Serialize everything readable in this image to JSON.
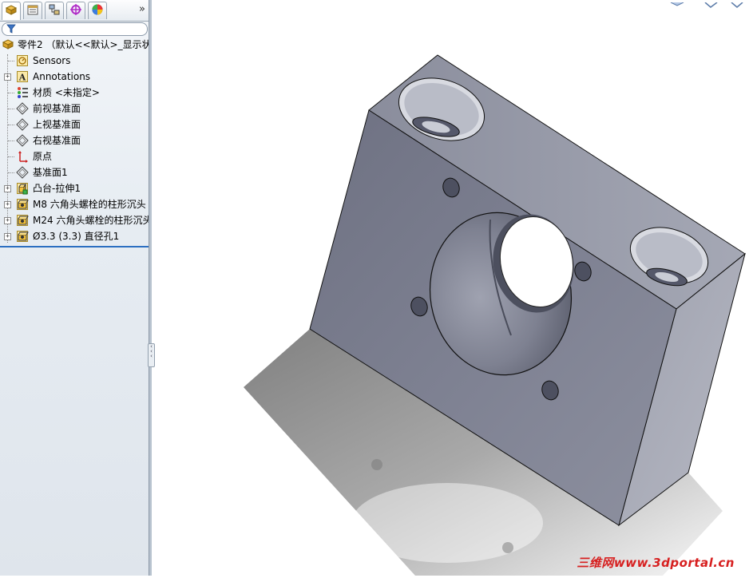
{
  "panel": {
    "tabs": [
      {
        "name": "featuremanager-tab",
        "icon": "feature-tree-icon"
      },
      {
        "name": "propertymanager-tab",
        "icon": "property-manager-icon"
      },
      {
        "name": "configurationmanager-tab",
        "icon": "configuration-icon"
      },
      {
        "name": "dimxpert-tab",
        "icon": "dimxpert-icon"
      },
      {
        "name": "display-manager-tab",
        "icon": "appearance-icon"
      }
    ],
    "more_label": "»",
    "filter_icon": "filter-icon"
  },
  "tree": {
    "root": {
      "label": "零件2 （默认<<默认>_显示状态",
      "icon": "part-icon"
    },
    "items": [
      {
        "label": "Sensors",
        "icon": "sensors-icon",
        "expandable": false
      },
      {
        "label": "Annotations",
        "icon": "annotations-icon",
        "expandable": true
      },
      {
        "label": "材质 <未指定>",
        "icon": "material-icon",
        "expandable": false
      },
      {
        "label": "前视基准面",
        "icon": "plane-icon",
        "expandable": false
      },
      {
        "label": "上视基准面",
        "icon": "plane-icon",
        "expandable": false
      },
      {
        "label": "右视基准面",
        "icon": "plane-icon",
        "expandable": false
      },
      {
        "label": "原点",
        "icon": "origin-icon",
        "expandable": false
      },
      {
        "label": "基准面1",
        "icon": "plane-icon",
        "expandable": false
      },
      {
        "label": "凸台-拉伸1",
        "icon": "extrude-icon",
        "expandable": true
      },
      {
        "label": "M8 六角头螺栓的柱形沉头",
        "icon": "hole-wizard-icon",
        "expandable": true
      },
      {
        "label": "M24 六角头螺栓的柱形沉头",
        "icon": "hole-wizard-icon",
        "expandable": true
      },
      {
        "label": "Ø3.3 (3.3) 直径孔1",
        "icon": "hole-wizard-icon",
        "expandable": true
      }
    ]
  },
  "viewport": {
    "watermark": "三维网www.3dportal.cn",
    "model": "bracket-block-with-counterbored-holes"
  },
  "colors": {
    "panel_bg": "#e3e9ef",
    "rollback_bar": "#2c6fc1",
    "model_face": "#7b7d8c",
    "watermark": "#d72020"
  }
}
